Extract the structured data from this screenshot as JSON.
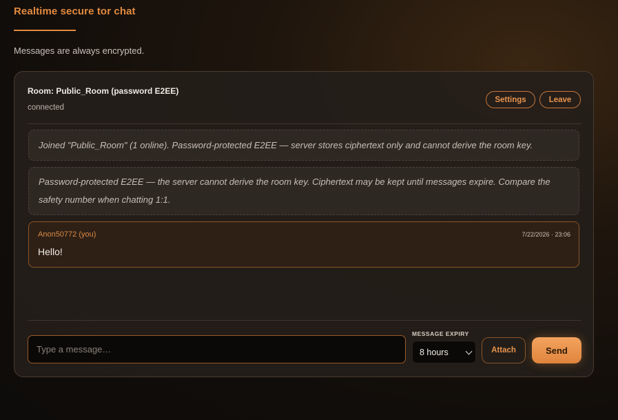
{
  "header": {
    "title": "Realtime secure tor chat",
    "subtitle": "Messages are always encrypted."
  },
  "room": {
    "name": "Room: Public_Room (password E2EE)",
    "status": "connected",
    "settings_label": "Settings",
    "leave_label": "Leave"
  },
  "system_messages": [
    "Joined \"Public_Room\" (1 online). Password-protected E2EE — server stores ciphertext only and cannot derive the room key.",
    "Password-protected E2EE — the server cannot derive the room key. Ciphertext may be kept until messages expire. Compare the safety number when chatting 1:1."
  ],
  "messages": [
    {
      "author": "Anon50772 (you)",
      "timestamp": "7/22/2026 · 23:06",
      "text": "Hello!"
    }
  ],
  "composer": {
    "placeholder": "Type a message…",
    "expiry_label": "MESSAGE EXPIRY",
    "expiry_value": "8 hours",
    "attach_label": "Attach",
    "send_label": "Send"
  },
  "colors": {
    "accent": "#e28a3f",
    "panel": "#241e1a",
    "message_bg": "#2f2016"
  }
}
